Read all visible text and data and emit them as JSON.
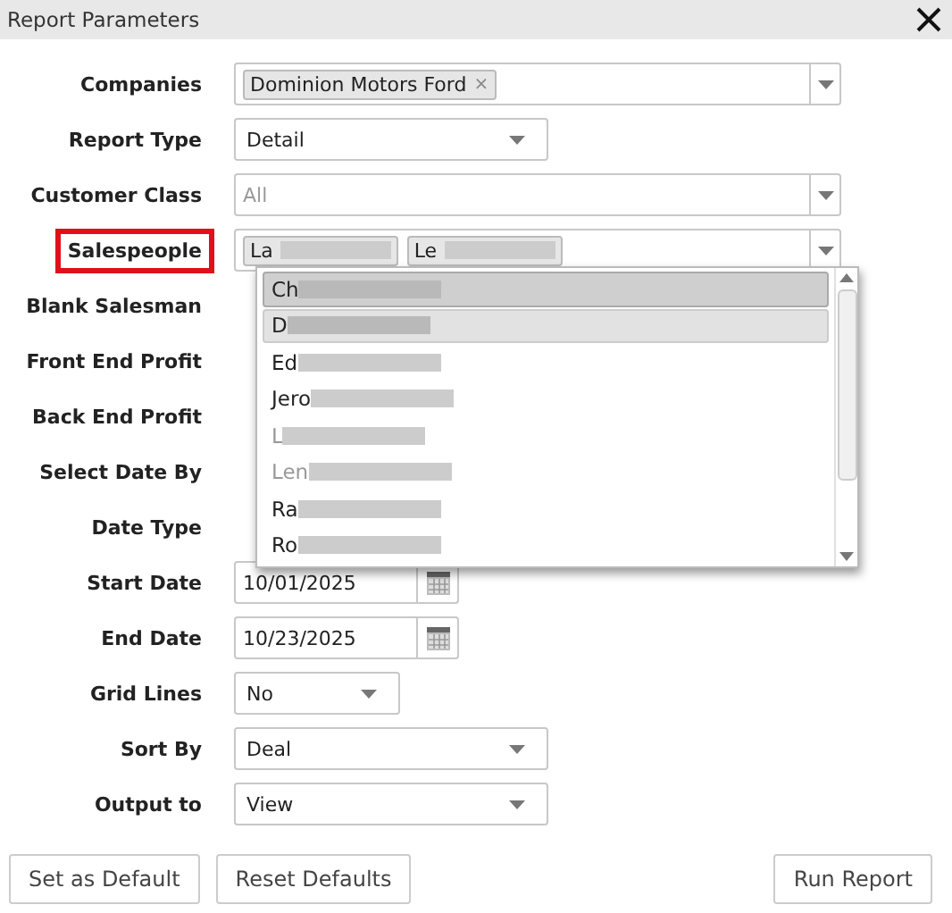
{
  "window": {
    "title": "Report Parameters"
  },
  "fields": [
    {
      "label": "Companies",
      "kind": "tags",
      "tags": [
        {
          "text": "Dominion Motors Ford",
          "blurred": false,
          "remove_icon": "×"
        }
      ],
      "highlighted": false
    },
    {
      "label": "Report Type",
      "kind": "select",
      "value": "Detail",
      "highlighted": false
    },
    {
      "label": "Customer Class",
      "kind": "combo",
      "placeholder": "All",
      "highlighted": false
    },
    {
      "label": "Salespeople",
      "kind": "tags",
      "tags": [
        {
          "text": "La",
          "blurred": true
        },
        {
          "text": "Le",
          "blurred": true
        }
      ],
      "highlighted": true
    },
    {
      "label": "Blank Salesman",
      "kind": "covered",
      "highlighted": false
    },
    {
      "label": "Front End Profit",
      "kind": "covered",
      "highlighted": false
    },
    {
      "label": "Back End Profit",
      "kind": "covered",
      "highlighted": false
    },
    {
      "label": "Select Date By",
      "kind": "covered",
      "highlighted": false
    },
    {
      "label": "Date Type",
      "kind": "covered",
      "highlighted": false
    },
    {
      "label": "Start Date",
      "kind": "date",
      "value": "10/01/2025",
      "highlighted": false
    },
    {
      "label": "End Date",
      "kind": "date",
      "value": "10/23/2025",
      "highlighted": false
    },
    {
      "label": "Grid Lines",
      "kind": "short-select",
      "value": "No",
      "highlighted": false
    },
    {
      "label": "Sort By",
      "kind": "select",
      "value": "Deal",
      "highlighted": false
    },
    {
      "label": "Output to",
      "kind": "select",
      "value": "View",
      "highlighted": false
    }
  ],
  "dropdown": {
    "items": [
      {
        "label": "Ch",
        "selected": true,
        "focused": true,
        "disabled": false
      },
      {
        "label": "D",
        "selected": true,
        "focused": false,
        "disabled": false
      },
      {
        "label": "Ed",
        "selected": false,
        "focused": false,
        "disabled": false
      },
      {
        "label": "Jero",
        "selected": false,
        "focused": false,
        "disabled": false
      },
      {
        "label": "L",
        "selected": false,
        "focused": false,
        "disabled": true
      },
      {
        "label": "Len",
        "selected": false,
        "focused": false,
        "disabled": true
      },
      {
        "label": "Ra",
        "selected": false,
        "focused": false,
        "disabled": false
      },
      {
        "label": "Ro",
        "selected": false,
        "focused": false,
        "disabled": false
      }
    ]
  },
  "left_buttons": [
    "Set as Default",
    "Reset Defaults"
  ],
  "right_buttons": [
    "Run Report"
  ]
}
